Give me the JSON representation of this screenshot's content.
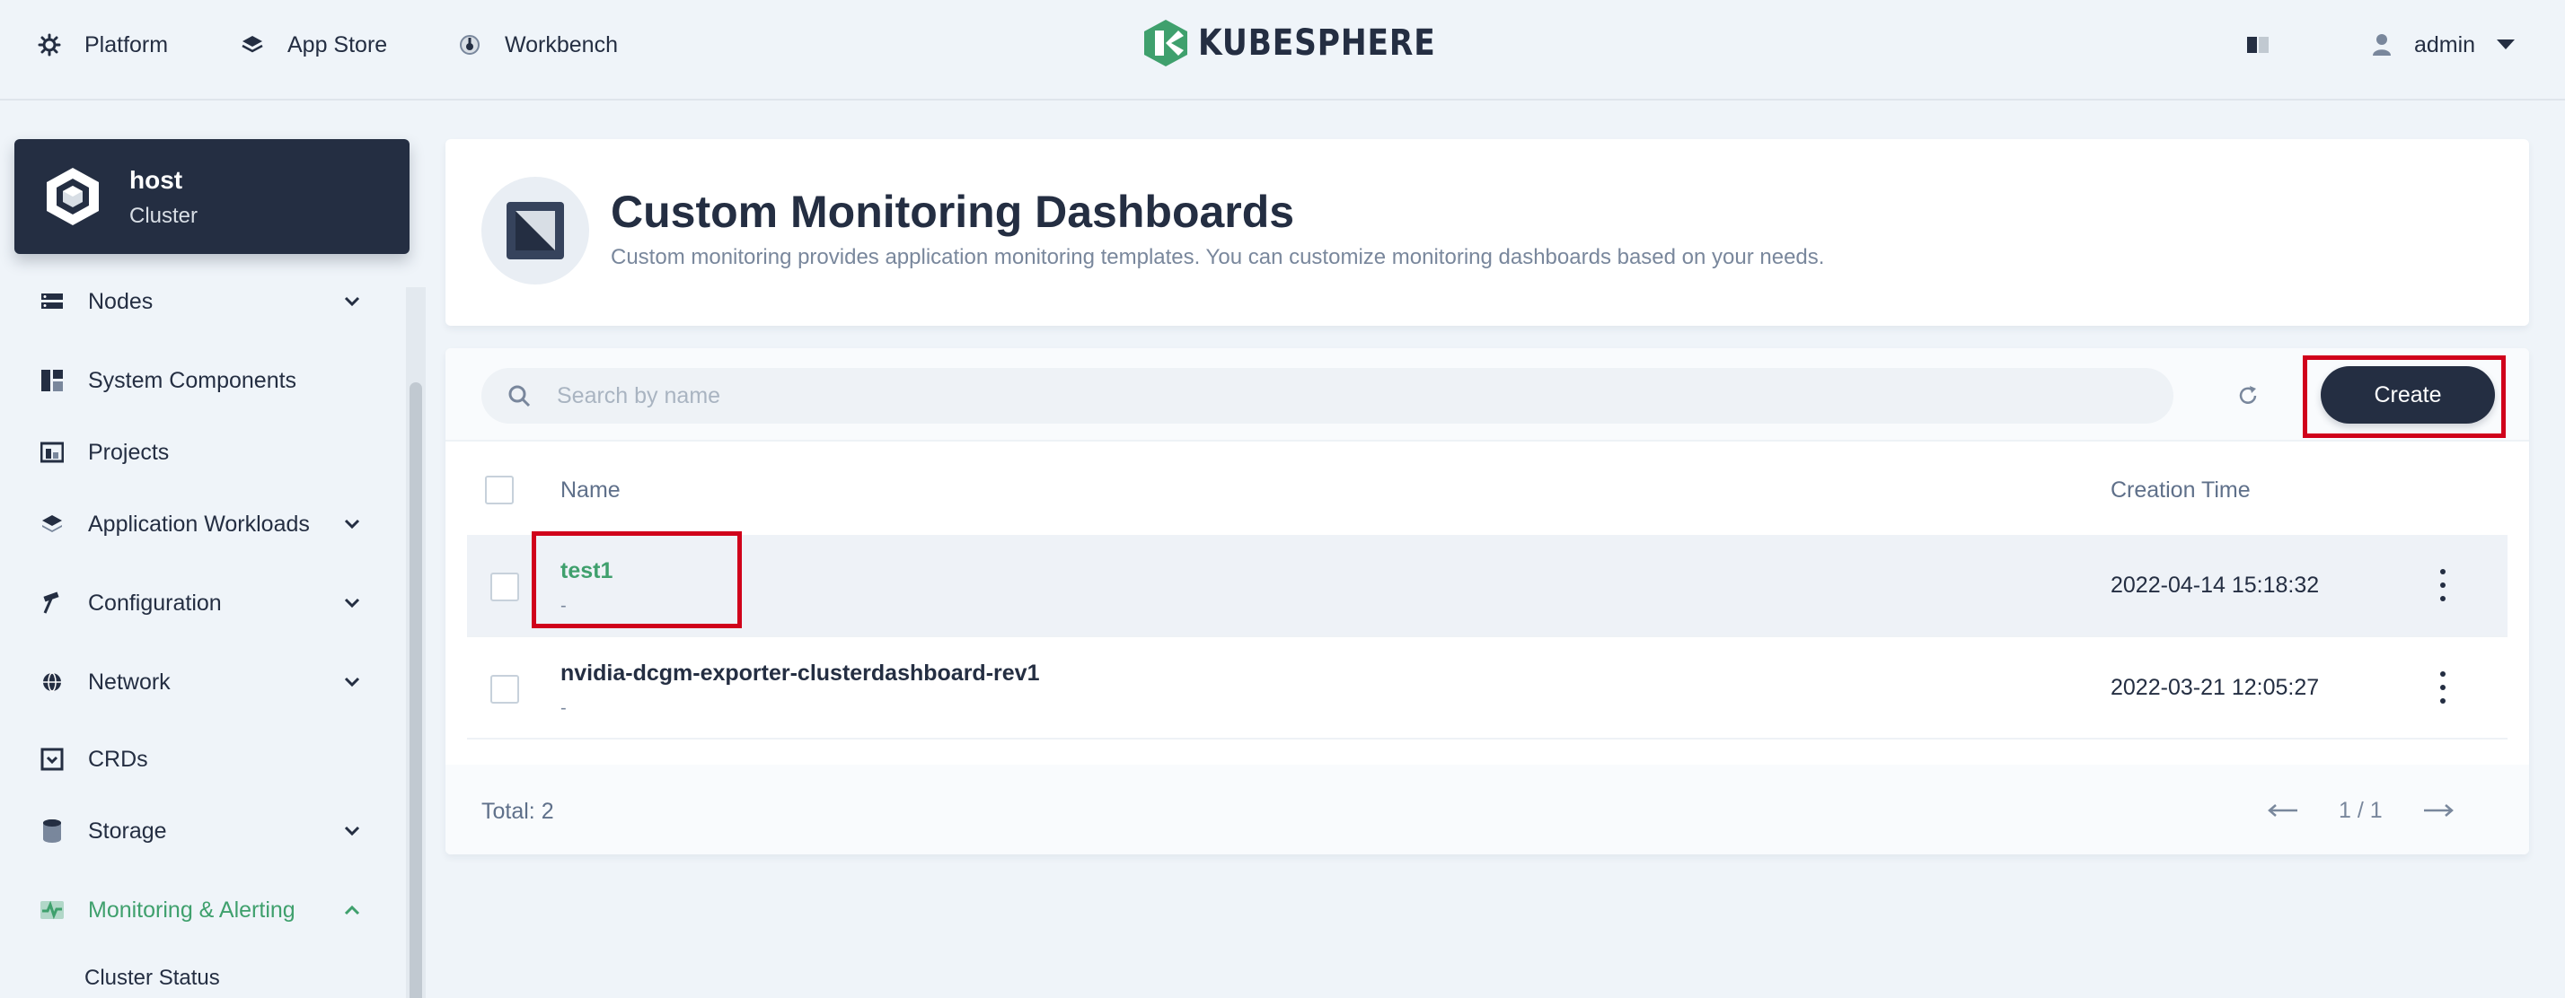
{
  "topnav": {
    "items": [
      {
        "label": "Platform",
        "icon": "gear-icon"
      },
      {
        "label": "App Store",
        "icon": "layers-icon"
      },
      {
        "label": "Workbench",
        "icon": "dashboard-icon"
      }
    ],
    "brand": "KUBESPHERE",
    "user": "admin"
  },
  "cluster": {
    "name": "host",
    "type": "Cluster"
  },
  "sidebar": {
    "items": [
      {
        "label": "Nodes",
        "icon": "nodes-icon",
        "expandable": true
      },
      {
        "label": "System Components",
        "icon": "components-icon",
        "expandable": false
      },
      {
        "label": "Projects",
        "icon": "projects-icon",
        "expandable": false
      },
      {
        "label": "Application Workloads",
        "icon": "workloads-icon",
        "expandable": true
      },
      {
        "label": "Configuration",
        "icon": "hammer-icon",
        "expandable": true
      },
      {
        "label": "Network",
        "icon": "network-icon",
        "expandable": true
      },
      {
        "label": "CRDs",
        "icon": "crd-icon",
        "expandable": false
      },
      {
        "label": "Storage",
        "icon": "storage-icon",
        "expandable": true
      },
      {
        "label": "Monitoring & Alerting",
        "icon": "monitoring-icon",
        "expandable": true,
        "active": true
      }
    ],
    "sub_items": [
      "Cluster Status"
    ]
  },
  "header": {
    "title": "Custom Monitoring Dashboards",
    "description": "Custom monitoring provides application monitoring templates. You can customize monitoring dashboards based on your needs."
  },
  "toolbar": {
    "search_placeholder": "Search by name",
    "create_label": "Create"
  },
  "table": {
    "columns": [
      "Name",
      "Creation Time"
    ],
    "rows": [
      {
        "name": "test1",
        "sub": "-",
        "time": "2022-04-14 15:18:32"
      },
      {
        "name": "nvidia-dcgm-exporter-clusterdashboard-rev1",
        "sub": "-",
        "time": "2022-03-21 12:05:27"
      }
    ],
    "total": "Total: 2",
    "page": "1 / 1"
  },
  "colors": {
    "accent": "#3fa06d",
    "dark": "#242e42",
    "highlight": "#d0021b"
  }
}
